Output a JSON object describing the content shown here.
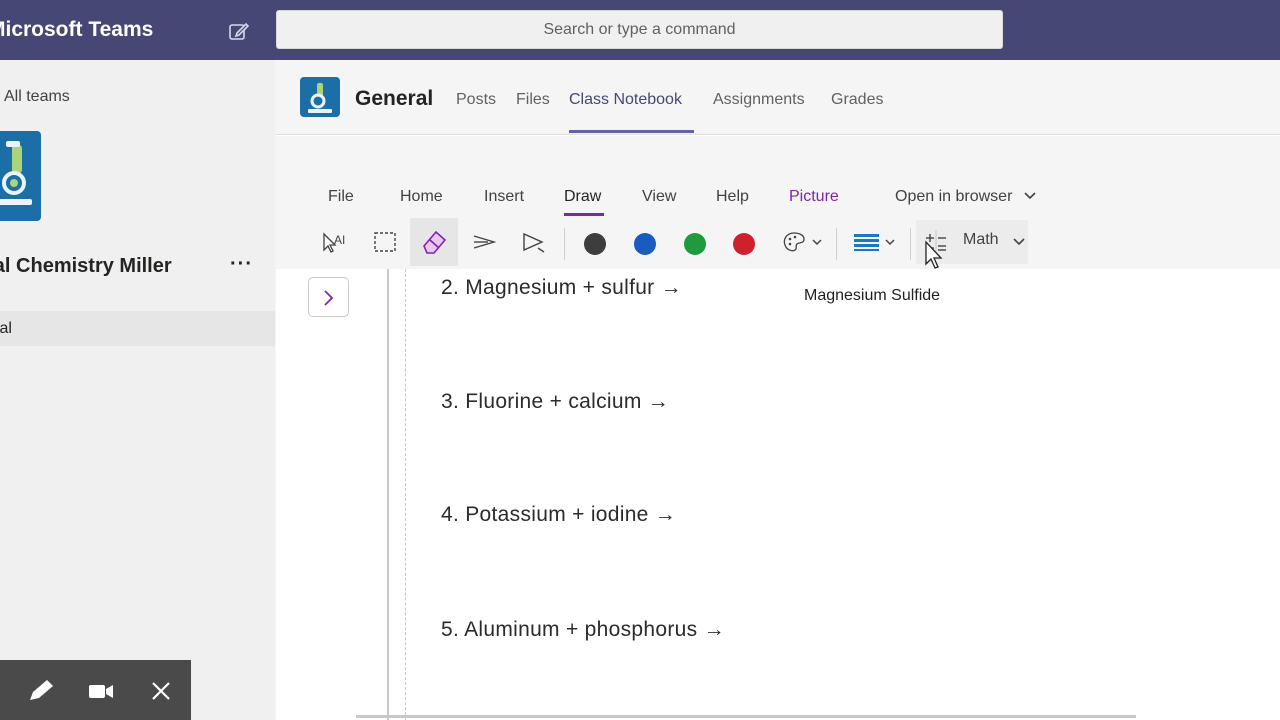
{
  "topbar": {
    "app_title": "Microsoft Teams",
    "search_placeholder": "Search or type a command"
  },
  "left_panel": {
    "back_label": "All teams",
    "team_name": "General Chemistry Miller",
    "more_label": "···",
    "channels": [
      {
        "label": "General",
        "selected": true
      }
    ]
  },
  "channel_header": {
    "title": "General",
    "tabs": [
      {
        "label": "Posts",
        "active": false
      },
      {
        "label": "Files",
        "active": false
      },
      {
        "label": "Class Notebook",
        "active": true
      },
      {
        "label": "Assignments",
        "active": false
      },
      {
        "label": "Grades",
        "active": false
      }
    ]
  },
  "ribbon": {
    "tabs": [
      {
        "label": "File"
      },
      {
        "label": "Home"
      },
      {
        "label": "Insert"
      },
      {
        "label": "Draw",
        "active": true
      },
      {
        "label": "View"
      },
      {
        "label": "Help"
      },
      {
        "label": "Picture"
      }
    ],
    "open_in_browser": "Open in browser",
    "math_label": "Math",
    "pen_colors": [
      "#3d3d3d",
      "#1a5bbf",
      "#1f9a3c",
      "#d0202e"
    ],
    "accent": "#8025a8"
  },
  "page": {
    "problems": [
      "2.  Magnesium  +  sulfur  →",
      "3.  Fluorine  +  calcium  →",
      "4.  Potassium  +  iodine  →",
      "5.  Aluminum  +  phosphorus  →"
    ],
    "answer_text": "Magnesium Sulfide"
  },
  "colors": {
    "topbar": "#464775",
    "teams_accent": "#6264a7",
    "onenote_accent": "#8025a8"
  }
}
